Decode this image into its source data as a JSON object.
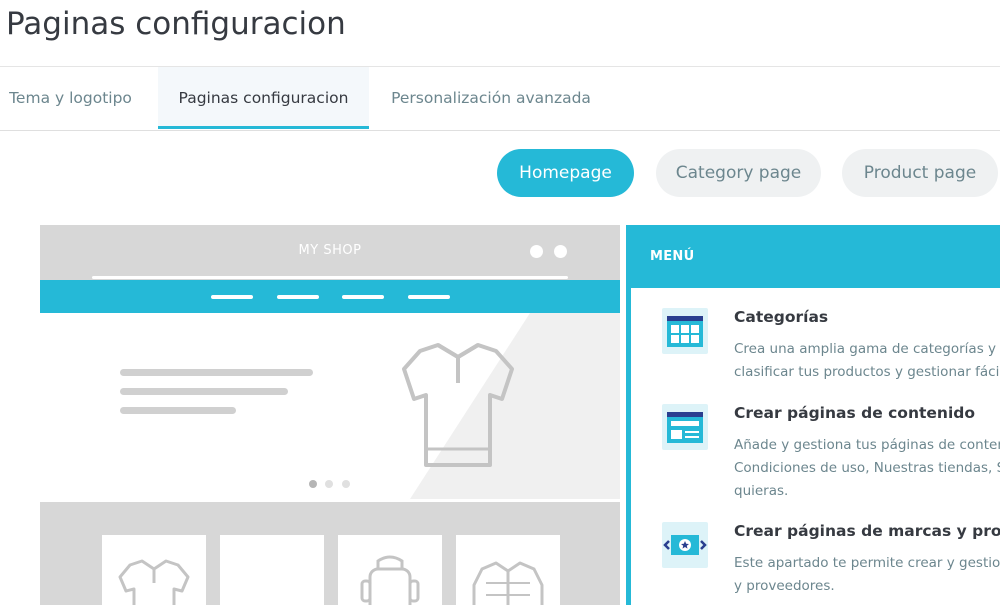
{
  "page": {
    "title": "Paginas configuracion"
  },
  "tabs": [
    {
      "label": "Tema y logotipo",
      "active": false
    },
    {
      "label": "Paginas configuracion",
      "active": true
    },
    {
      "label": "Personalización avanzada",
      "active": false
    }
  ],
  "page_type_buttons": [
    {
      "label": "Homepage",
      "active": true
    },
    {
      "label": "Category page",
      "active": false
    },
    {
      "label": "Product page",
      "active": false
    }
  ],
  "preview": {
    "shop_name": "MY SHOP",
    "product_icons": [
      "polo-shirt-icon",
      "polo-shirt-icon",
      "backpack-icon",
      "jacket-icon"
    ]
  },
  "menu": {
    "title": "MENÚ",
    "items": [
      {
        "icon": "categories-icon",
        "title": "Categorías",
        "description_line1": "Crea una amplia gama de categorías y s",
        "description_line2": "clasificar tus productos y gestionar fáci"
      },
      {
        "icon": "content-page-icon",
        "title": "Crear páginas de contenido",
        "description_line1": "Añade y gestiona tus páginas de conter",
        "description_line2": "Condiciones de uso, Nuestras tiendas, S",
        "description_line3": "quieras."
      },
      {
        "icon": "brands-carousel-icon",
        "title": "Crear páginas de marcas y provee",
        "description_line1": "Este apartado te permite crear y gestio",
        "description_line2": "y proveedores."
      }
    ]
  },
  "colors": {
    "accent": "#25b9d7",
    "text": "#363a41",
    "muted": "#6c868e",
    "preview_gray": "#d7d7d7"
  }
}
